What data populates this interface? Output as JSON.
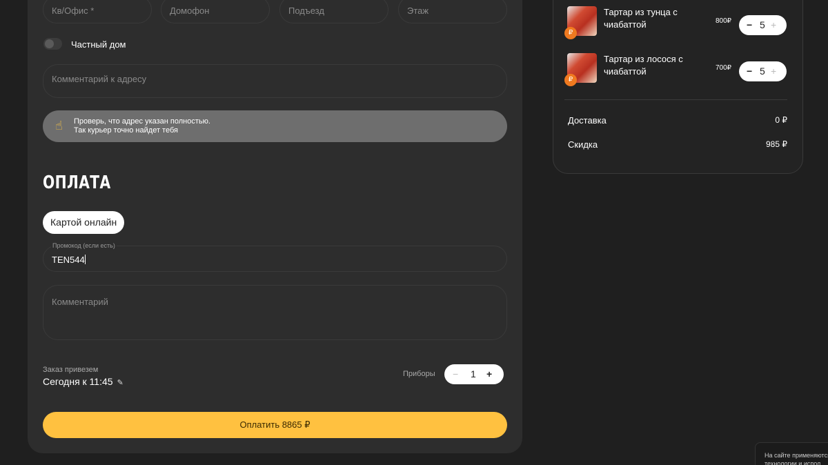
{
  "address": {
    "apartment_placeholder": "Кв/Офис *",
    "intercom_placeholder": "Домофон",
    "entrance_placeholder": "Подъезд",
    "floor_placeholder": "Этаж",
    "private_house_label": "Частный дом",
    "comment_placeholder": "Комментарий к адресу",
    "notice_line1": "Проверь, что адрес указан полностью.",
    "notice_line2": "Так курьер точно найдет тебя",
    "notice_icon": "pointing-hand-icon"
  },
  "payment": {
    "title": "ОПЛАТА",
    "method_label": "Картой онлайн",
    "promo_label": "Промокод (если есть)",
    "promo_value": "TEN544",
    "comment_placeholder": "Комментарий",
    "delivery_label": "Заказ привезем",
    "delivery_time": "Сегодня к 11:45",
    "cutlery_label": "Приборы",
    "cutlery_count": "1",
    "pay_button": "Оплатить 8865 ₽"
  },
  "cart": {
    "items": [
      {
        "name": "Тартар из тунца с чиабаттой",
        "price": "800₽",
        "qty": "5",
        "badge": "₽"
      },
      {
        "name": "Тартар из лосося с чиабаттой",
        "price": "700₽",
        "qty": "5",
        "badge": "₽"
      }
    ],
    "delivery_label": "Доставка",
    "delivery_value": "0 ₽",
    "discount_label": "Скидка",
    "discount_value": "985 ₽"
  },
  "cookie": {
    "line1": "На сайте применяются",
    "line2": "технологии и испол"
  },
  "colors": {
    "accent": "#ffc140",
    "badge": "#f07a20",
    "background": "#1f1f1f",
    "card": "#2d2d2d"
  }
}
